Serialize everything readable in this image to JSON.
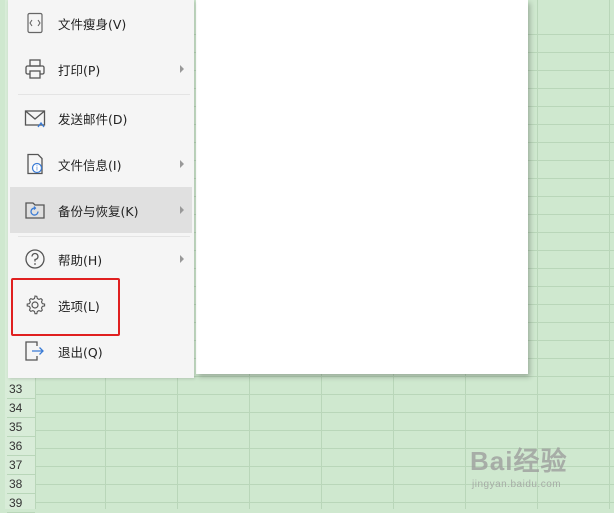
{
  "menu": {
    "items": [
      {
        "label": "文件瘦身(V)",
        "icon": "file-slim-icon",
        "submenu": false,
        "hover": false
      },
      {
        "label": "打印(P)",
        "icon": "printer-icon",
        "submenu": true,
        "hover": false
      },
      {
        "label": "发送邮件(D)",
        "icon": "mail-icon",
        "submenu": false,
        "hover": false
      },
      {
        "label": "文件信息(I)",
        "icon": "file-info-icon",
        "submenu": true,
        "hover": false
      },
      {
        "label": "备份与恢复(K)",
        "icon": "backup-restore-icon",
        "submenu": true,
        "hover": true
      },
      {
        "label": "帮助(H)",
        "icon": "help-icon",
        "submenu": true,
        "hover": false
      },
      {
        "label": "选项(L)",
        "icon": "gear-icon",
        "submenu": false,
        "hover": false
      },
      {
        "label": "退出(Q)",
        "icon": "exit-icon",
        "submenu": false,
        "hover": false
      }
    ]
  },
  "spreadsheet": {
    "row_numbers": [
      "33",
      "34",
      "35",
      "36",
      "37",
      "38",
      "39"
    ]
  },
  "watermark": {
    "main": "Bai经验",
    "sub": "jingyan.baidu.com"
  },
  "colors": {
    "sheet_bg": "#cfe8cf",
    "menu_bg": "#f5f5f5",
    "hover_bg": "#e0e0e0",
    "highlight": "#e02020"
  }
}
